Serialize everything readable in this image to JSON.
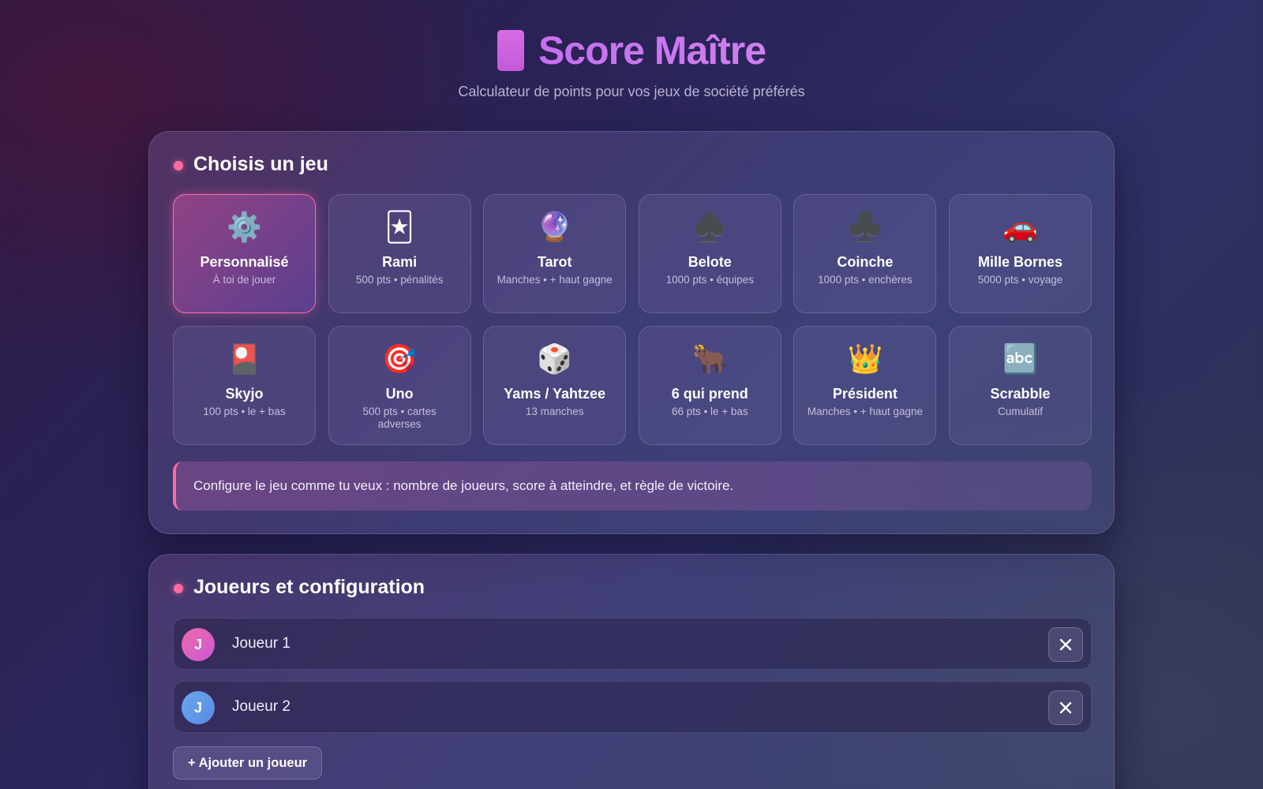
{
  "header": {
    "title": "Score Maître",
    "subtitle": "Calculateur de points pour vos jeux de société préférés"
  },
  "games_section": {
    "title": "Choisis un jeu",
    "games": [
      {
        "icon": "⚙️",
        "icon_name": "gear-icon",
        "name": "Personnalisé",
        "desc": "À toi de jouer",
        "selected": true
      },
      {
        "icon": "🃏",
        "icon_name": "joker-card-icon",
        "name": "Rami",
        "desc": "500 pts • pénalités",
        "selected": false
      },
      {
        "icon": "🔮",
        "icon_name": "crystal-ball-icon",
        "name": "Tarot",
        "desc": "Manches • + haut gagne",
        "selected": false
      },
      {
        "icon": "♠️",
        "icon_name": "spade-icon",
        "name": "Belote",
        "desc": "1000 pts • équipes",
        "selected": false
      },
      {
        "icon": "♣️",
        "icon_name": "club-icon",
        "name": "Coinche",
        "desc": "1000 pts • enchères",
        "selected": false
      },
      {
        "icon": "🚗",
        "icon_name": "car-icon",
        "name": "Mille Bornes",
        "desc": "5000 pts • voyage",
        "selected": false
      },
      {
        "icon": "🎴",
        "icon_name": "flower-card-icon",
        "name": "Skyjo",
        "desc": "100 pts • le + bas",
        "selected": false
      },
      {
        "icon": "🎯",
        "icon_name": "target-icon",
        "name": "Uno",
        "desc": "500 pts • cartes adverses",
        "selected": false
      },
      {
        "icon": "🎲",
        "icon_name": "dice-icon",
        "name": "Yams / Yahtzee",
        "desc": "13 manches",
        "selected": false
      },
      {
        "icon": "🐂",
        "icon_name": "ox-icon",
        "name": "6 qui prend",
        "desc": "66 pts • le + bas",
        "selected": false
      },
      {
        "icon": "👑",
        "icon_name": "crown-icon",
        "name": "Président",
        "desc": "Manches • + haut gagne",
        "selected": false
      },
      {
        "icon": "🔤",
        "icon_name": "abc-letters-icon",
        "name": "Scrabble",
        "desc": "Cumulatif",
        "selected": false
      }
    ],
    "info": "Configure le jeu comme tu veux : nombre de joueurs, score à atteindre, et règle de victoire."
  },
  "players_section": {
    "title": "Joueurs et configuration",
    "players": [
      {
        "initial": "J",
        "name": "Joueur 1",
        "avatar_color": "#e065b8"
      },
      {
        "initial": "J",
        "name": "Joueur 2",
        "avatar_color": "#64a0ee"
      }
    ],
    "add_label": "+ Ajouter un joueur"
  },
  "colors": {
    "accent_pink": "#ff6b9d",
    "title_purple": "#cf6ff0"
  }
}
